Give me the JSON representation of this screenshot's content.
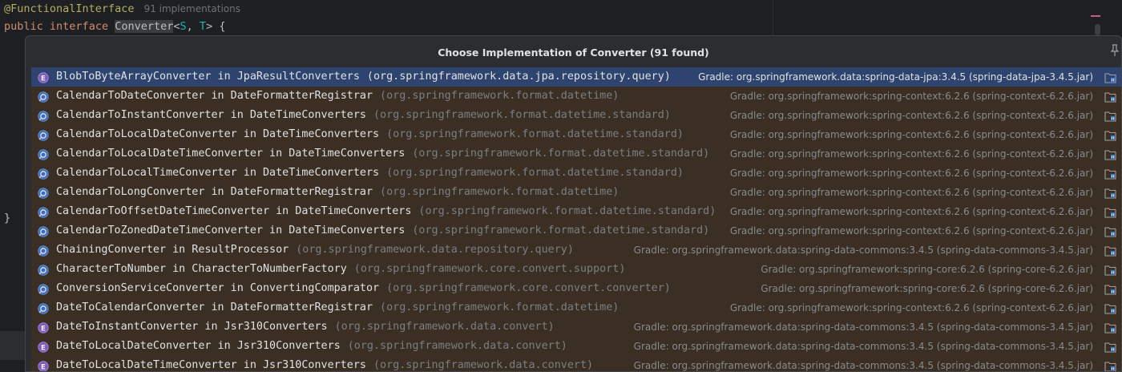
{
  "editor": {
    "annotation": "@FunctionalInterface",
    "impl_hint": "91 implementations",
    "kw_public": "public",
    "kw_interface": "interface",
    "type_name": "Converter",
    "type_params_open": "<",
    "param_s": "S",
    "comma": ", ",
    "param_t": "T",
    "type_params_close": "> {",
    "closing_brace": "}"
  },
  "popup": {
    "title": "Choose Implementation of Converter (91 found)",
    "pin_icon": "pin-icon",
    "items": [
      {
        "icon": "enum-class-icon",
        "name": "BlobToByteArrayConverter in JpaResultConverters",
        "pkg": "(org.springframework.data.jpa.repository.query)",
        "lib": "Gradle: org.springframework.data:spring-data-jpa:3.4.5 (spring-data-jpa-3.4.5.jar)"
      },
      {
        "icon": "class-icon",
        "name": "CalendarToDateConverter in DateFormatterRegistrar",
        "pkg": "(org.springframework.format.datetime)",
        "lib": "Gradle: org.springframework:spring-context:6.2.6 (spring-context-6.2.6.jar)"
      },
      {
        "icon": "class-icon",
        "name": "CalendarToInstantConverter in DateTimeConverters",
        "pkg": "(org.springframework.format.datetime.standard)",
        "lib": "Gradle: org.springframework:spring-context:6.2.6 (spring-context-6.2.6.jar)"
      },
      {
        "icon": "class-icon",
        "name": "CalendarToLocalDateConverter in DateTimeConverters",
        "pkg": "(org.springframework.format.datetime.standard)",
        "lib": "Gradle: org.springframework:spring-context:6.2.6 (spring-context-6.2.6.jar)"
      },
      {
        "icon": "class-icon",
        "name": "CalendarToLocalDateTimeConverter in DateTimeConverters",
        "pkg": "(org.springframework.format.datetime.standard)",
        "lib": "Gradle: org.springframework:spring-context:6.2.6 (spring-context-6.2.6.jar)"
      },
      {
        "icon": "class-icon",
        "name": "CalendarToLocalTimeConverter in DateTimeConverters",
        "pkg": "(org.springframework.format.datetime.standard)",
        "lib": "Gradle: org.springframework:spring-context:6.2.6 (spring-context-6.2.6.jar)"
      },
      {
        "icon": "class-icon",
        "name": "CalendarToLongConverter in DateFormatterRegistrar",
        "pkg": "(org.springframework.format.datetime)",
        "lib": "Gradle: org.springframework:spring-context:6.2.6 (spring-context-6.2.6.jar)"
      },
      {
        "icon": "class-icon",
        "name": "CalendarToOffsetDateTimeConverter in DateTimeConverters",
        "pkg": "(org.springframework.format.datetime.standard)",
        "lib": "Gradle: org.springframework:spring-context:6.2.6 (spring-context-6.2.6.jar)"
      },
      {
        "icon": "class-icon",
        "name": "CalendarToZonedDateTimeConverter in DateTimeConverters",
        "pkg": "(org.springframework.format.datetime.standard)",
        "lib": "Gradle: org.springframework:spring-context:6.2.6 (spring-context-6.2.6.jar)"
      },
      {
        "icon": "class-icon",
        "name": "ChainingConverter in ResultProcessor",
        "pkg": "(org.springframework.data.repository.query)",
        "lib": "Gradle: org.springframework.data:spring-data-commons:3.4.5 (spring-data-commons-3.4.5.jar)"
      },
      {
        "icon": "class-icon",
        "name": "CharacterToNumber in CharacterToNumberFactory",
        "pkg": "(org.springframework.core.convert.support)",
        "lib": "Gradle: org.springframework:spring-core:6.2.6 (spring-core-6.2.6.jar)"
      },
      {
        "icon": "class-icon",
        "name": "ConversionServiceConverter in ConvertingComparator",
        "pkg": "(org.springframework.core.convert.converter)",
        "lib": "Gradle: org.springframework:spring-core:6.2.6 (spring-core-6.2.6.jar)"
      },
      {
        "icon": "class-icon",
        "name": "DateToCalendarConverter in DateFormatterRegistrar",
        "pkg": "(org.springframework.format.datetime)",
        "lib": "Gradle: org.springframework:spring-context:6.2.6 (spring-context-6.2.6.jar)"
      },
      {
        "icon": "enum-class-icon",
        "name": "DateToInstantConverter in Jsr310Converters",
        "pkg": "(org.springframework.data.convert)",
        "lib": "Gradle: org.springframework.data:spring-data-commons:3.4.5 (spring-data-commons-3.4.5.jar)"
      },
      {
        "icon": "enum-class-icon",
        "name": "DateToLocalDateConverter in Jsr310Converters",
        "pkg": "(org.springframework.data.convert)",
        "lib": "Gradle: org.springframework.data:spring-data-commons:3.4.5 (spring-data-commons-3.4.5.jar)"
      },
      {
        "icon": "enum-class-icon",
        "name": "DateToLocalDateTimeConverter in Jsr310Converters",
        "pkg": "(org.springframework.data.convert)",
        "lib": "Gradle: org.springframework.data:spring-data-commons:3.4.5 (spring-data-commons-3.4.5.jar)"
      }
    ]
  }
}
